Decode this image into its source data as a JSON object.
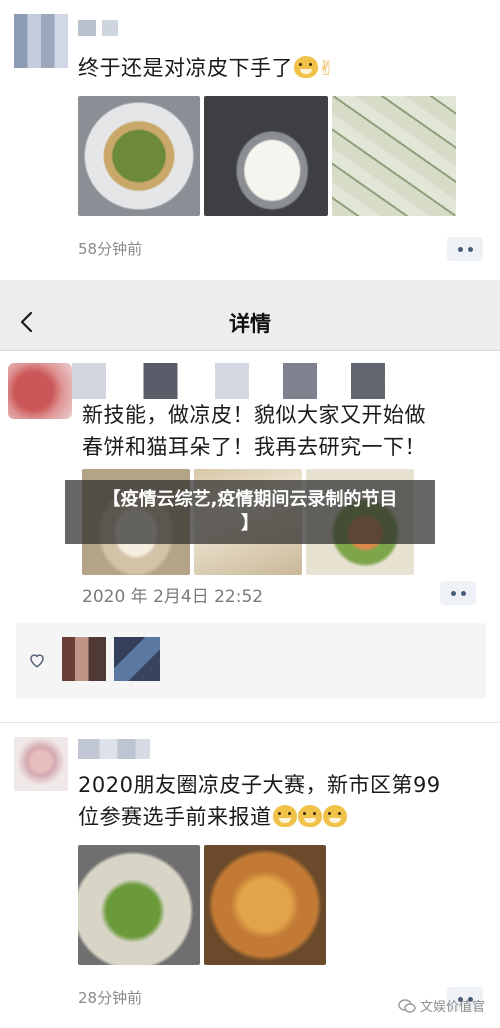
{
  "post1": {
    "text": "终于还是对凉皮下手了",
    "time": "58分钟前"
  },
  "header": {
    "title": "详情"
  },
  "post2": {
    "text_line1": "新技能，做凉皮！貌似大家又开始做",
    "text_line2": "春饼和猫耳朵了！我再去研究一下！",
    "time": "2020 年 2月4日 22:52"
  },
  "banner": {
    "line1": "【疫情云综艺,疫情期间云录制的节目",
    "line2": "】"
  },
  "post3": {
    "text_line1": "2020朋友圈凉皮子大赛，新市区第99",
    "text_line2": "位参赛选手前来报道",
    "time": "28分钟前"
  },
  "watermark": {
    "text": "文娱价值官"
  },
  "icons": [
    "back-arrow-icon",
    "like-heart-icon",
    "more-dots-icon",
    "wechat-icon"
  ]
}
